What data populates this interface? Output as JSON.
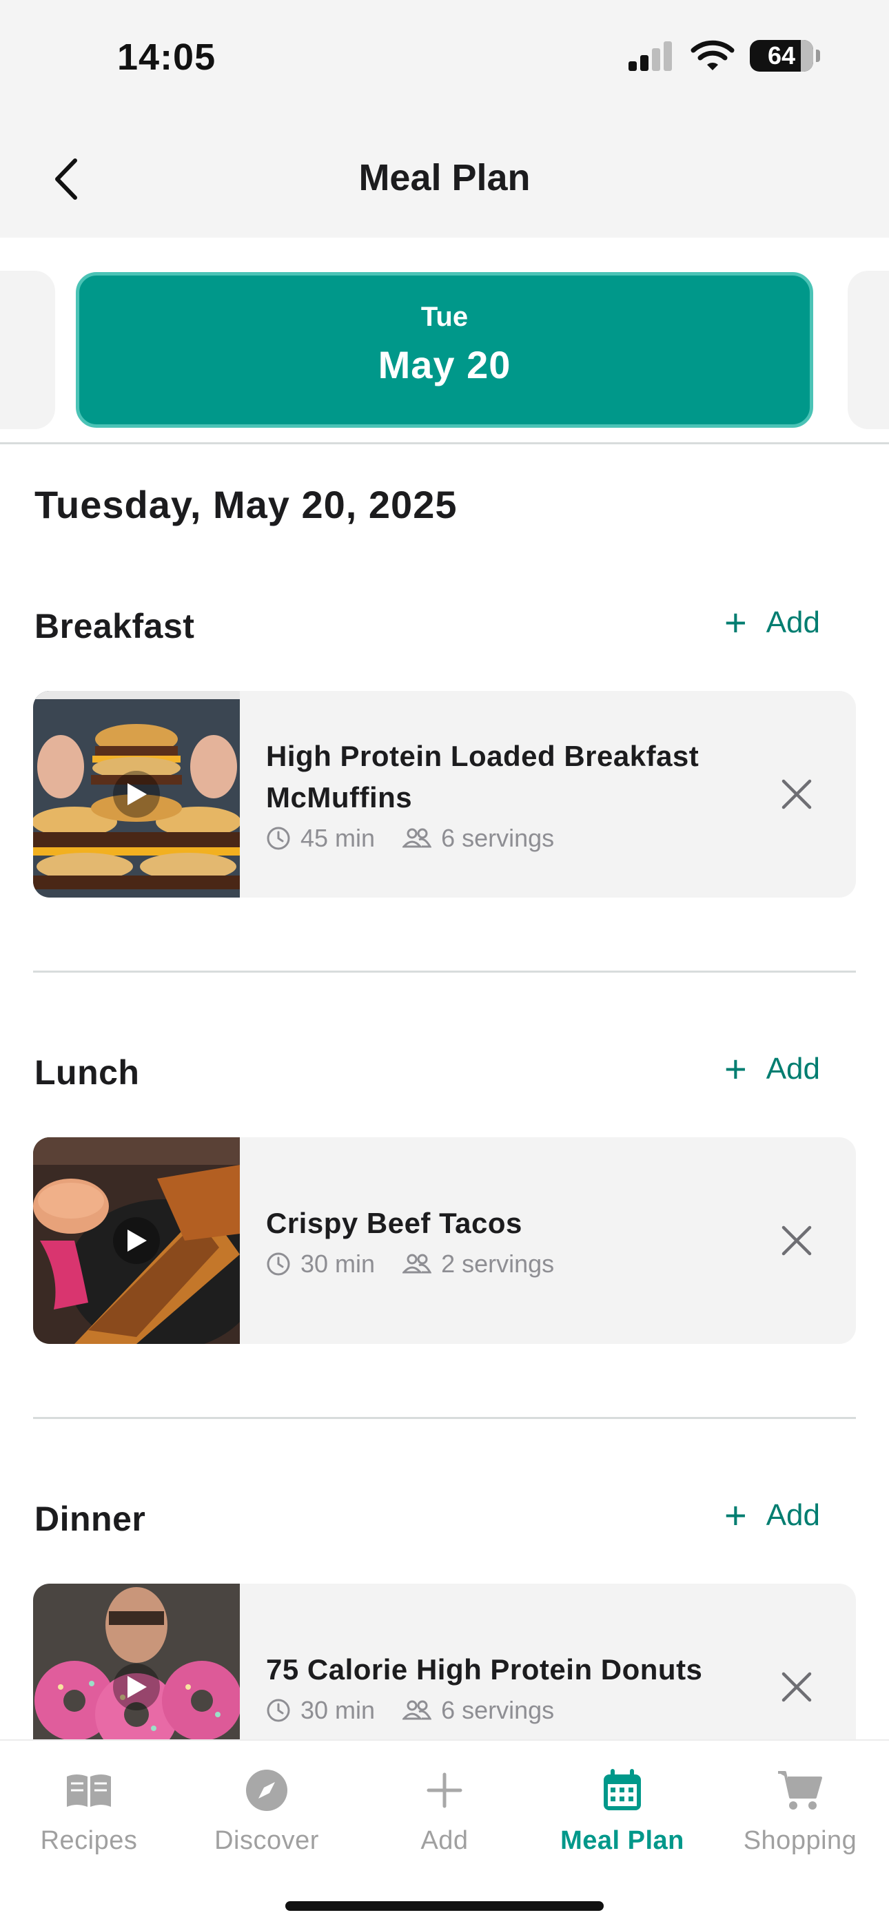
{
  "status": {
    "time": "14:05",
    "battery": "64"
  },
  "nav": {
    "title": "Meal Plan"
  },
  "selected_date": {
    "weekday": "Tue",
    "day": "May 20"
  },
  "full_date": "Tuesday, May 20, 2025",
  "add_label": "Add",
  "meals": [
    {
      "title": "Breakfast",
      "recipe": {
        "name": "High Protein Loaded Breakfast McMuffins",
        "time": "45 min",
        "servings": "6 servings"
      }
    },
    {
      "title": "Lunch",
      "recipe": {
        "name": "Crispy Beef Tacos",
        "time": "30 min",
        "servings": "2 servings"
      }
    },
    {
      "title": "Dinner",
      "recipe": {
        "name": "75 Calorie High Protein Donuts",
        "time": "30 min",
        "servings": "6 servings"
      }
    }
  ],
  "tabs": [
    {
      "label": "Recipes",
      "icon": "book-icon"
    },
    {
      "label": "Discover",
      "icon": "compass-icon"
    },
    {
      "label": "Add",
      "icon": "plus-icon"
    },
    {
      "label": "Meal Plan",
      "icon": "calendar-icon",
      "active": true
    },
    {
      "label": "Shopping",
      "icon": "cart-icon"
    }
  ],
  "colors": {
    "accent": "#00988a",
    "accent_dark": "#007d70",
    "card_bg": "#f3f3f3"
  }
}
